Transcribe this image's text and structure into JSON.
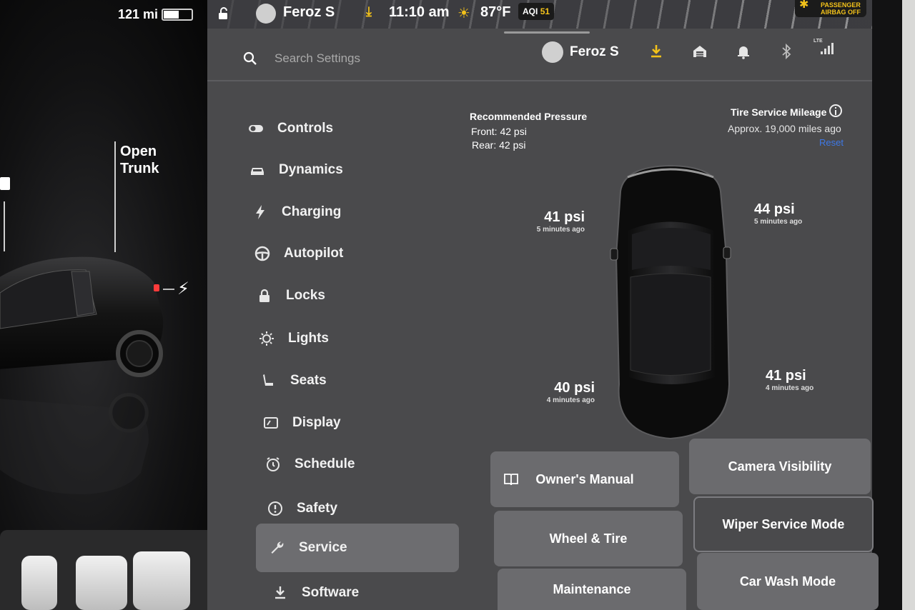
{
  "car_panel": {
    "range": "121 mi",
    "battery_level": 0.55,
    "trunk_label": "Open Trunk"
  },
  "status_bar": {
    "user": "Feroz S",
    "time": "11:10 am",
    "temperature": "87°F",
    "aqi_label": "AQI",
    "aqi_value": "51",
    "airbag_line1": "PASSENGER",
    "airbag_line2": "AIRBAG OFF"
  },
  "header": {
    "search_placeholder": "Search Settings",
    "user": "Feroz S",
    "icons": [
      "download-icon",
      "garage-icon",
      "bell-icon",
      "bluetooth-icon",
      "lte-signal-icon"
    ],
    "lte_label": "LTE"
  },
  "nav": {
    "items": [
      {
        "label": "Controls",
        "icon": "toggle-icon"
      },
      {
        "label": "Dynamics",
        "icon": "car-icon"
      },
      {
        "label": "Charging",
        "icon": "bolt-icon"
      },
      {
        "label": "Autopilot",
        "icon": "steering-wheel-icon"
      },
      {
        "label": "Locks",
        "icon": "lock-icon"
      },
      {
        "label": "Lights",
        "icon": "light-icon"
      },
      {
        "label": "Seats",
        "icon": "seat-icon"
      },
      {
        "label": "Display",
        "icon": "display-icon"
      },
      {
        "label": "Schedule",
        "icon": "alarm-clock-icon"
      },
      {
        "label": "Safety",
        "icon": "alert-circle-icon"
      },
      {
        "label": "Service",
        "icon": "wrench-icon"
      },
      {
        "label": "Software",
        "icon": "download-icon"
      }
    ],
    "active": "Service"
  },
  "tires": {
    "recommended_title": "Recommended Pressure",
    "recommended_front": "Front: 42 psi",
    "recommended_rear": "Rear: 42 psi",
    "service_title": "Tire Service Mileage",
    "service_value": "Approx. 19,000 miles ago",
    "reset_label": "Reset",
    "front_left": {
      "psi": "41 psi",
      "ago": "5 minutes ago"
    },
    "front_right": {
      "psi": "44 psi",
      "ago": "5 minutes ago"
    },
    "rear_left": {
      "psi": "40 psi",
      "ago": "4 minutes ago"
    },
    "rear_right": {
      "psi": "41 psi",
      "ago": "4 minutes ago"
    }
  },
  "tiles": {
    "owners_manual": "Owner's Manual",
    "camera_visibility": "Camera Visibility",
    "wheel_tire": "Wheel & Tire",
    "wiper_service": "Wiper Service Mode",
    "maintenance": "Maintenance",
    "car_wash": "Car Wash Mode"
  },
  "colors": {
    "accent_yellow": "#f3c21a",
    "link_blue": "#3e78e6",
    "panel": "#4a4a4c",
    "active_item": "#6d6d70"
  }
}
